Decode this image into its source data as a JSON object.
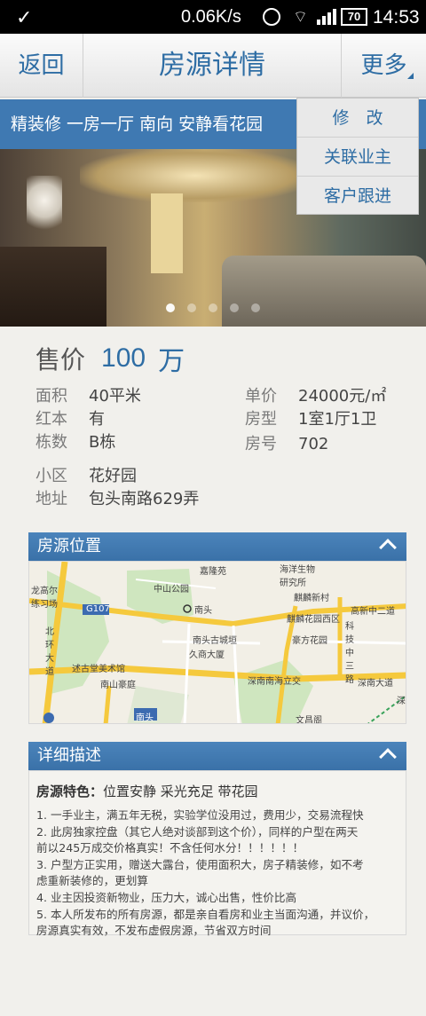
{
  "status_bar": {
    "speed": "0.06K/s",
    "battery": "70",
    "time": "14:53"
  },
  "nav": {
    "back": "返回",
    "title": "房源详情",
    "more": "更多"
  },
  "menu": {
    "items": [
      "修　改",
      "关联业主",
      "客户跟进"
    ]
  },
  "headline": "精装修  一房一厅  南向  安静看花园",
  "carousel": {
    "count": 5,
    "active": 0
  },
  "price": {
    "label": "售价",
    "value": "100",
    "unit": "万"
  },
  "details_left": [
    {
      "key": "面积",
      "value": "40平米"
    },
    {
      "key": "红本",
      "value": "有"
    },
    {
      "key": "栋数",
      "value": "B栋"
    }
  ],
  "details_right": [
    {
      "key": "单价",
      "value": "24000元/㎡"
    },
    {
      "key": "房型",
      "value": "1室1厅1卫"
    },
    {
      "key": "房号",
      "value": "702"
    }
  ],
  "community": {
    "key": "小区",
    "value": "花好园"
  },
  "address": {
    "key": "地址",
    "value": "包头南路629弄"
  },
  "location_panel": {
    "title": "房源位置",
    "map_labels": [
      "嘉隆苑",
      "海洋生物研究所",
      "中山公园",
      "麒麟新村",
      "龙高尔练习场",
      "G107",
      "南头",
      "麒麟花园西区",
      "高新中二道",
      "北环大道",
      "南头古城垣",
      "豪方花园",
      "科技中三路",
      "久商大厦",
      "述古堂美术馆",
      "南山豪庭",
      "深南南海立交",
      "深南大道",
      "南头",
      "文昌阁",
      "深"
    ]
  },
  "description_panel": {
    "title": "详细描述",
    "feature_label": "房源特色：",
    "feature_value": "位置安静  采光充足  带花园",
    "lines": [
      "1. 一手业主，满五年无税，实验学位没用过，费用少，交易流程快",
      "2. 此房独家控盘（其它人绝对谈部到这个价），同样的户型在两天",
      "前以245万成交价格真实！不含任何水分！！！！！！",
      "3. 户型方正实用，赠送大露台，使用面积大，房子精装修，如不考",
      "虑重新装修的，更划算",
      "4. 业主因投资新物业，压力大，诚心出售，性价比高",
      "5. 本人所发布的所有房源，都是亲自看房和业主当面沟通，并议价，",
      "房源真实有效，不发布虚假房源，节省双方时间"
    ]
  },
  "colors": {
    "accent": "#2e6da4",
    "band": "#3f79b2",
    "page_bg": "#f1f0ec"
  }
}
